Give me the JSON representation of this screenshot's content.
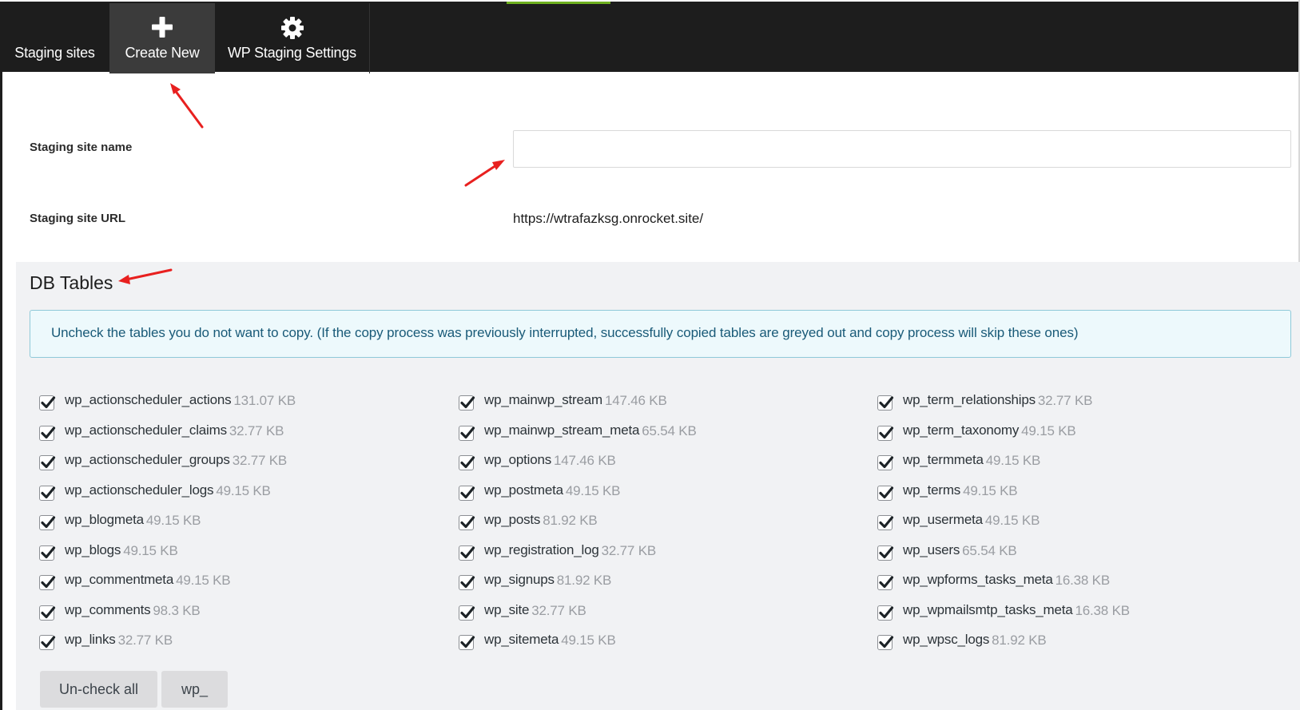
{
  "nav": {
    "tabs": [
      {
        "label": "Staging sites",
        "icon": ""
      },
      {
        "label": "Create New",
        "icon": "plus-icon"
      },
      {
        "label": "WP Staging Settings",
        "icon": "gear-icon"
      }
    ],
    "active_tab": "Create New",
    "accent_color": "#6eb01f"
  },
  "form": {
    "name_label": "Staging site name",
    "name_value": "",
    "url_label": "Staging site URL",
    "url_value": "https://wtrafazksg.onrocket.site/"
  },
  "db": {
    "title": "DB Tables",
    "notice": "Uncheck the tables you do not want to copy. (If the copy process was previously interrupted, successfully copied tables are greyed out and copy process will skip these ones)",
    "columns": [
      [
        {
          "name": "wp_actionscheduler_actions",
          "size": "131.07 KB",
          "checked": true
        },
        {
          "name": "wp_actionscheduler_claims",
          "size": "32.77 KB",
          "checked": true
        },
        {
          "name": "wp_actionscheduler_groups",
          "size": "32.77 KB",
          "checked": true
        },
        {
          "name": "wp_actionscheduler_logs",
          "size": "49.15 KB",
          "checked": true
        },
        {
          "name": "wp_blogmeta",
          "size": "49.15 KB",
          "checked": true
        },
        {
          "name": "wp_blogs",
          "size": "49.15 KB",
          "checked": true
        },
        {
          "name": "wp_commentmeta",
          "size": "49.15 KB",
          "checked": true
        },
        {
          "name": "wp_comments",
          "size": "98.3 KB",
          "checked": true
        },
        {
          "name": "wp_links",
          "size": "32.77 KB",
          "checked": true
        }
      ],
      [
        {
          "name": "wp_mainwp_stream",
          "size": "147.46 KB",
          "checked": true
        },
        {
          "name": "wp_mainwp_stream_meta",
          "size": "65.54 KB",
          "checked": true
        },
        {
          "name": "wp_options",
          "size": "147.46 KB",
          "checked": true
        },
        {
          "name": "wp_postmeta",
          "size": "49.15 KB",
          "checked": true
        },
        {
          "name": "wp_posts",
          "size": "81.92 KB",
          "checked": true
        },
        {
          "name": "wp_registration_log",
          "size": "32.77 KB",
          "checked": true
        },
        {
          "name": "wp_signups",
          "size": "81.92 KB",
          "checked": true
        },
        {
          "name": "wp_site",
          "size": "32.77 KB",
          "checked": true
        },
        {
          "name": "wp_sitemeta",
          "size": "49.15 KB",
          "checked": true
        }
      ],
      [
        {
          "name": "wp_term_relationships",
          "size": "32.77 KB",
          "checked": true
        },
        {
          "name": "wp_term_taxonomy",
          "size": "49.15 KB",
          "checked": true
        },
        {
          "name": "wp_termmeta",
          "size": "49.15 KB",
          "checked": true
        },
        {
          "name": "wp_terms",
          "size": "49.15 KB",
          "checked": true
        },
        {
          "name": "wp_usermeta",
          "size": "49.15 KB",
          "checked": true
        },
        {
          "name": "wp_users",
          "size": "65.54 KB",
          "checked": true
        },
        {
          "name": "wp_wpforms_tasks_meta",
          "size": "16.38 KB",
          "checked": true
        },
        {
          "name": "wp_wpmailsmtp_tasks_meta",
          "size": "16.38 KB",
          "checked": true
        },
        {
          "name": "wp_wpsc_logs",
          "size": "81.92 KB",
          "checked": true
        }
      ]
    ],
    "buttons": {
      "uncheck_all": "Un-check all",
      "prefix": "wp_"
    }
  },
  "annotation_color": "#e8201f"
}
